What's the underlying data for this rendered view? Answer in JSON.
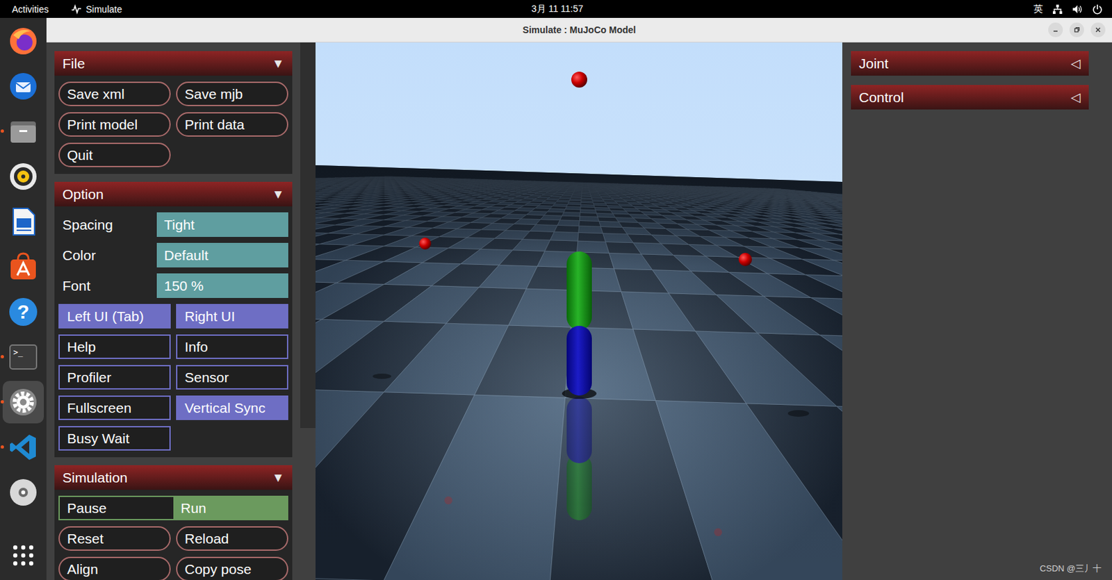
{
  "topbar": {
    "activities": "Activities",
    "app_name": "Simulate",
    "clock": "3月 11 11:57",
    "input_method": "英"
  },
  "dock": {
    "items": [
      {
        "running": false,
        "selected": false
      },
      {
        "running": false,
        "selected": false
      },
      {
        "running": true,
        "selected": false
      },
      {
        "running": false,
        "selected": false
      },
      {
        "running": false,
        "selected": false
      },
      {
        "running": false,
        "selected": false
      },
      {
        "running": false,
        "selected": false,
        "glyph": "?"
      },
      {
        "running": true,
        "selected": false,
        "glyph": ">_"
      },
      {
        "running": true,
        "selected": true
      },
      {
        "running": true,
        "selected": false
      },
      {
        "running": false,
        "selected": false
      }
    ]
  },
  "window": {
    "title": "Simulate : MuJoCo Model"
  },
  "left_ui": {
    "sections": [
      {
        "title": "File",
        "expanded": true,
        "toggle_icon": "▼",
        "items": [
          {
            "kind": "button",
            "label": "Save xml"
          },
          {
            "kind": "button",
            "label": "Save mjb"
          },
          {
            "kind": "button",
            "label": "Print model"
          },
          {
            "kind": "button",
            "label": "Print data"
          },
          {
            "kind": "button",
            "label": "Quit"
          }
        ]
      },
      {
        "title": "Option",
        "expanded": true,
        "toggle_icon": "▼",
        "items": [
          {
            "kind": "select",
            "label": "Spacing",
            "value": "Tight"
          },
          {
            "kind": "select",
            "label": "Color",
            "value": "Default"
          },
          {
            "kind": "select",
            "label": "Font",
            "value": "150 %"
          },
          {
            "kind": "toggle",
            "label": "Left UI (Tab)",
            "on": true
          },
          {
            "kind": "toggle",
            "label": "Right UI",
            "on": true
          },
          {
            "kind": "toggle",
            "label": "Help",
            "on": false
          },
          {
            "kind": "toggle",
            "label": "Info",
            "on": false
          },
          {
            "kind": "toggle",
            "label": "Profiler",
            "on": false
          },
          {
            "kind": "toggle",
            "label": "Sensor",
            "on": false
          },
          {
            "kind": "toggle",
            "label": "Fullscreen",
            "on": false
          },
          {
            "kind": "toggle",
            "label": "Vertical Sync",
            "on": true
          },
          {
            "kind": "toggle",
            "label": "Busy Wait",
            "on": false
          }
        ]
      },
      {
        "title": "Simulation",
        "expanded": true,
        "toggle_icon": "▼",
        "items": [
          {
            "kind": "radio",
            "options": [
              {
                "label": "Pause",
                "selected": false
              },
              {
                "label": "Run",
                "selected": true
              }
            ]
          },
          {
            "kind": "button",
            "label": "Reset"
          },
          {
            "kind": "button",
            "label": "Reload"
          },
          {
            "kind": "button",
            "label": "Align"
          },
          {
            "kind": "button",
            "label": "Copy pose"
          }
        ]
      }
    ]
  },
  "right_ui": {
    "sections": [
      {
        "title": "Joint",
        "expanded": false,
        "toggle_icon": "◁"
      },
      {
        "title": "Control",
        "expanded": false,
        "toggle_icon": "◁"
      }
    ]
  },
  "watermark": "CSDN @三丿十"
}
